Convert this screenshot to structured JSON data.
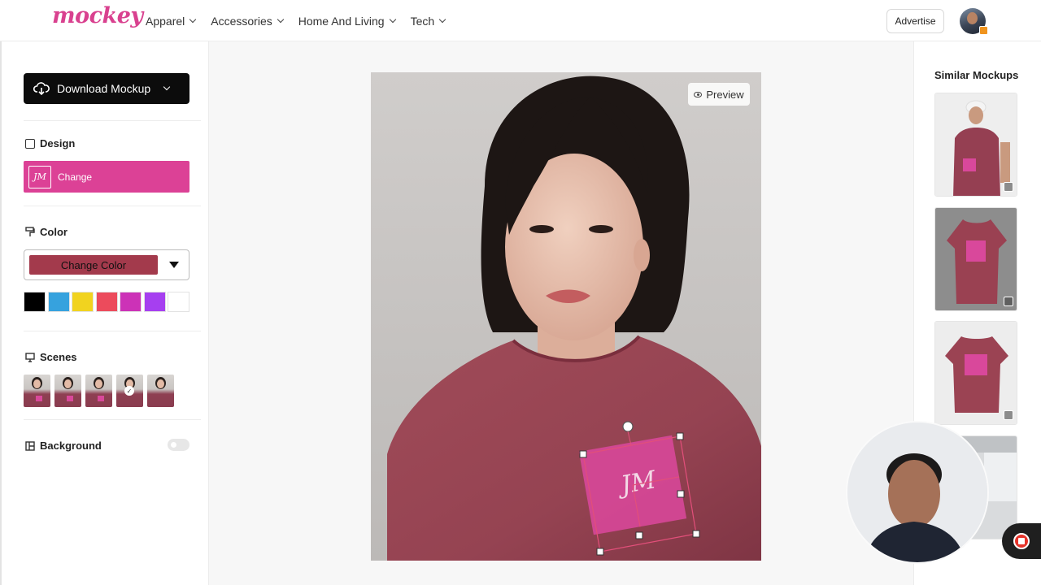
{
  "header": {
    "logo_text": "mockey",
    "nav": [
      {
        "label": "Apparel"
      },
      {
        "label": "Accessories"
      },
      {
        "label": "Home And Living"
      },
      {
        "label": "Tech"
      }
    ],
    "advertise_label": "Advertise",
    "avatar_icon": "user-avatar"
  },
  "sidebar": {
    "download_label": "Download Mockup",
    "design": {
      "title": "Design",
      "button_label": "Change",
      "thumb_text": "JM"
    },
    "color": {
      "title": "Color",
      "select_label": "Change Color",
      "selected_hex": "#a33a4c",
      "swatches": [
        "#000000",
        "#36a2de",
        "#f1d31f",
        "#ec4b5c",
        "#cc32b7",
        "#a63ff0",
        "#ffffff"
      ]
    },
    "scenes": {
      "title": "Scenes",
      "count": 5,
      "selected_index": 3
    },
    "background": {
      "title": "Background",
      "enabled": false
    }
  },
  "canvas": {
    "preview_label": "Preview",
    "shirt_color": "#9b4452",
    "design_color": "#d9489b",
    "design_text": "JM"
  },
  "similar": {
    "title": "Similar Mockups",
    "items": [
      {
        "name": "polo-model"
      },
      {
        "name": "polo-front"
      },
      {
        "name": "polo-back"
      },
      {
        "name": "interior-scene"
      }
    ]
  },
  "accent_color": "#dc4196"
}
